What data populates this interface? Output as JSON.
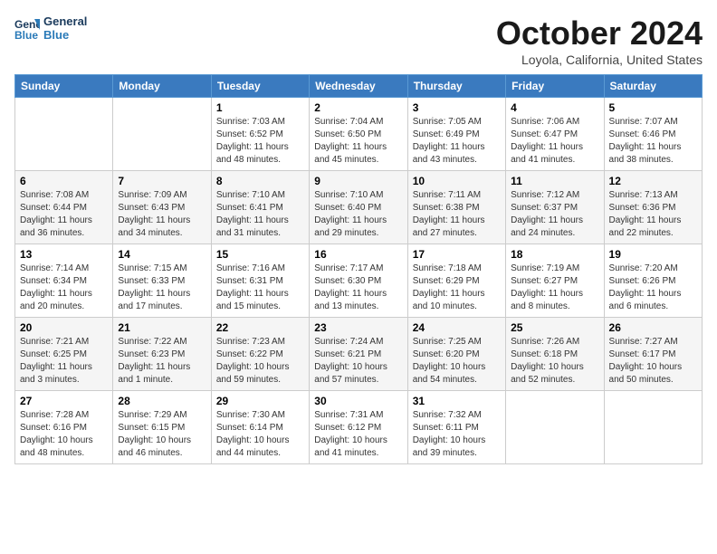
{
  "logo": {
    "line1": "General",
    "line2": "Blue"
  },
  "title": "October 2024",
  "subtitle": "Loyola, California, United States",
  "days_of_week": [
    "Sunday",
    "Monday",
    "Tuesday",
    "Wednesday",
    "Thursday",
    "Friday",
    "Saturday"
  ],
  "weeks": [
    [
      {
        "day": "",
        "info": ""
      },
      {
        "day": "",
        "info": ""
      },
      {
        "day": "1",
        "info": "Sunrise: 7:03 AM\nSunset: 6:52 PM\nDaylight: 11 hours and 48 minutes."
      },
      {
        "day": "2",
        "info": "Sunrise: 7:04 AM\nSunset: 6:50 PM\nDaylight: 11 hours and 45 minutes."
      },
      {
        "day": "3",
        "info": "Sunrise: 7:05 AM\nSunset: 6:49 PM\nDaylight: 11 hours and 43 minutes."
      },
      {
        "day": "4",
        "info": "Sunrise: 7:06 AM\nSunset: 6:47 PM\nDaylight: 11 hours and 41 minutes."
      },
      {
        "day": "5",
        "info": "Sunrise: 7:07 AM\nSunset: 6:46 PM\nDaylight: 11 hours and 38 minutes."
      }
    ],
    [
      {
        "day": "6",
        "info": "Sunrise: 7:08 AM\nSunset: 6:44 PM\nDaylight: 11 hours and 36 minutes."
      },
      {
        "day": "7",
        "info": "Sunrise: 7:09 AM\nSunset: 6:43 PM\nDaylight: 11 hours and 34 minutes."
      },
      {
        "day": "8",
        "info": "Sunrise: 7:10 AM\nSunset: 6:41 PM\nDaylight: 11 hours and 31 minutes."
      },
      {
        "day": "9",
        "info": "Sunrise: 7:10 AM\nSunset: 6:40 PM\nDaylight: 11 hours and 29 minutes."
      },
      {
        "day": "10",
        "info": "Sunrise: 7:11 AM\nSunset: 6:38 PM\nDaylight: 11 hours and 27 minutes."
      },
      {
        "day": "11",
        "info": "Sunrise: 7:12 AM\nSunset: 6:37 PM\nDaylight: 11 hours and 24 minutes."
      },
      {
        "day": "12",
        "info": "Sunrise: 7:13 AM\nSunset: 6:36 PM\nDaylight: 11 hours and 22 minutes."
      }
    ],
    [
      {
        "day": "13",
        "info": "Sunrise: 7:14 AM\nSunset: 6:34 PM\nDaylight: 11 hours and 20 minutes."
      },
      {
        "day": "14",
        "info": "Sunrise: 7:15 AM\nSunset: 6:33 PM\nDaylight: 11 hours and 17 minutes."
      },
      {
        "day": "15",
        "info": "Sunrise: 7:16 AM\nSunset: 6:31 PM\nDaylight: 11 hours and 15 minutes."
      },
      {
        "day": "16",
        "info": "Sunrise: 7:17 AM\nSunset: 6:30 PM\nDaylight: 11 hours and 13 minutes."
      },
      {
        "day": "17",
        "info": "Sunrise: 7:18 AM\nSunset: 6:29 PM\nDaylight: 11 hours and 10 minutes."
      },
      {
        "day": "18",
        "info": "Sunrise: 7:19 AM\nSunset: 6:27 PM\nDaylight: 11 hours and 8 minutes."
      },
      {
        "day": "19",
        "info": "Sunrise: 7:20 AM\nSunset: 6:26 PM\nDaylight: 11 hours and 6 minutes."
      }
    ],
    [
      {
        "day": "20",
        "info": "Sunrise: 7:21 AM\nSunset: 6:25 PM\nDaylight: 11 hours and 3 minutes."
      },
      {
        "day": "21",
        "info": "Sunrise: 7:22 AM\nSunset: 6:23 PM\nDaylight: 11 hours and 1 minute."
      },
      {
        "day": "22",
        "info": "Sunrise: 7:23 AM\nSunset: 6:22 PM\nDaylight: 10 hours and 59 minutes."
      },
      {
        "day": "23",
        "info": "Sunrise: 7:24 AM\nSunset: 6:21 PM\nDaylight: 10 hours and 57 minutes."
      },
      {
        "day": "24",
        "info": "Sunrise: 7:25 AM\nSunset: 6:20 PM\nDaylight: 10 hours and 54 minutes."
      },
      {
        "day": "25",
        "info": "Sunrise: 7:26 AM\nSunset: 6:18 PM\nDaylight: 10 hours and 52 minutes."
      },
      {
        "day": "26",
        "info": "Sunrise: 7:27 AM\nSunset: 6:17 PM\nDaylight: 10 hours and 50 minutes."
      }
    ],
    [
      {
        "day": "27",
        "info": "Sunrise: 7:28 AM\nSunset: 6:16 PM\nDaylight: 10 hours and 48 minutes."
      },
      {
        "day": "28",
        "info": "Sunrise: 7:29 AM\nSunset: 6:15 PM\nDaylight: 10 hours and 46 minutes."
      },
      {
        "day": "29",
        "info": "Sunrise: 7:30 AM\nSunset: 6:14 PM\nDaylight: 10 hours and 44 minutes."
      },
      {
        "day": "30",
        "info": "Sunrise: 7:31 AM\nSunset: 6:12 PM\nDaylight: 10 hours and 41 minutes."
      },
      {
        "day": "31",
        "info": "Sunrise: 7:32 AM\nSunset: 6:11 PM\nDaylight: 10 hours and 39 minutes."
      },
      {
        "day": "",
        "info": ""
      },
      {
        "day": "",
        "info": ""
      }
    ]
  ]
}
